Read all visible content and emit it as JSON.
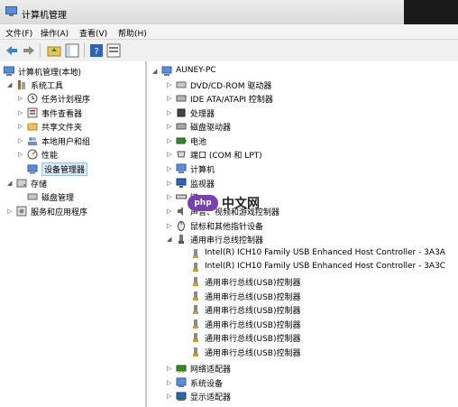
{
  "window": {
    "title": "计算机管理"
  },
  "menu": [
    {
      "label": "文件(F)"
    },
    {
      "label": "操作(A)"
    },
    {
      "label": "查看(V)"
    },
    {
      "label": "帮助(H)"
    }
  ],
  "toolbar": {
    "buttons": [
      {
        "icon": "back-arrow-icon"
      },
      {
        "icon": "forward-arrow-icon"
      },
      {
        "icon": "up-folder-icon"
      },
      {
        "icon": "show-hide-tree-icon"
      },
      {
        "icon": "help-icon"
      },
      {
        "icon": "properties-icon"
      }
    ]
  },
  "left_tree": {
    "root": "计算机管理(本地)",
    "system_tools": "系统工具",
    "task_scheduler": "任务计划程序",
    "event_viewer": "事件查看器",
    "shared_folders": "共享文件夹",
    "local_users": "本地用户和组",
    "performance": "性能",
    "device_manager": "设备管理器",
    "storage": "存储",
    "disk_management": "磁盘管理",
    "services_apps": "服务和应用程序"
  },
  "right_tree": {
    "computer": "AUNEY-PC",
    "categories": [
      "DVD/CD-ROM 驱动器",
      "IDE ATA/ATAPI 控制器",
      "处理器",
      "磁盘驱动器",
      "电池",
      "端口 (COM 和 LPT)",
      "计算机",
      "监视器",
      "键",
      "声音、视频和游戏控制器",
      "鼠标和其他指针设备",
      "通用串行总线控制器"
    ],
    "usb_children": [
      "Intel(R) ICH10 Family USB Enhanced Host Controller - 3A3A",
      "Intel(R) ICH10 Family USB Enhanced Host Controller - 3A3C",
      "通用串行总线(USB)控制器",
      "通用串行总线(USB)控制器",
      "通用串行总线(USB)控制器",
      "通用串行总线(USB)控制器",
      "通用串行总线(USB)控制器",
      "通用串行总线(USB)控制器"
    ],
    "after_usb": [
      "网络适配器",
      "系统设备",
      "显示适配器"
    ]
  },
  "watermark": {
    "logo": "php",
    "text": "中文网"
  }
}
